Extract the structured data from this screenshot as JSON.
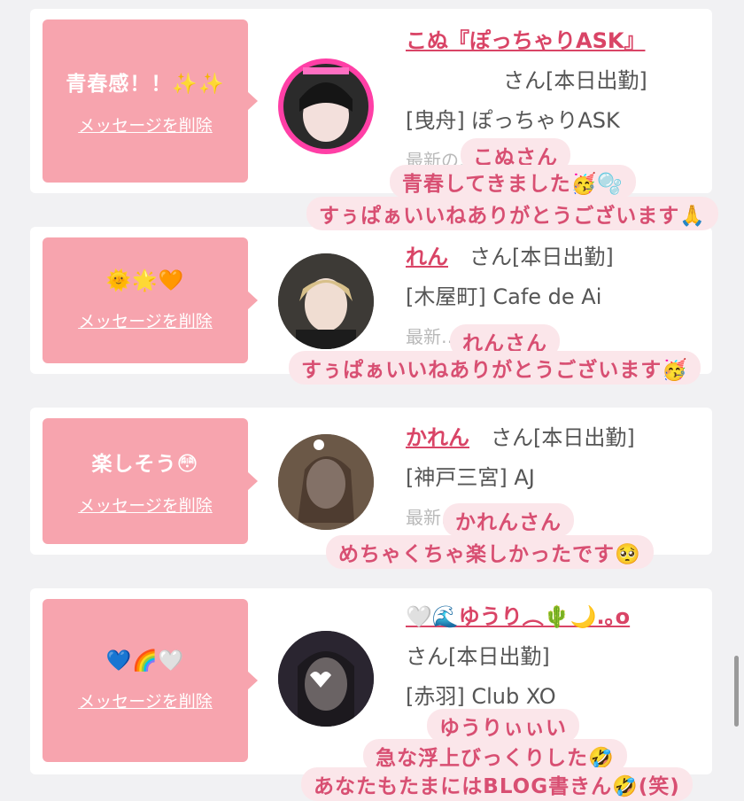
{
  "cards": [
    {
      "message": "青春感！！✨✨",
      "delete_label": "メッセージを削除",
      "name": "こぬ『ぽっちゃりASK』",
      "san": "さん[本日出勤]",
      "shop": "[曳舟] ぽっちゃりASK",
      "faded": "最新の…見る",
      "overlay": [
        "こぬさん",
        "青春してきました🥳🫧",
        "すぅぱぁいいねありがとうございます🙏"
      ]
    },
    {
      "message": "🌞🌟🧡",
      "delete_label": "メッセージを削除",
      "name": "れん",
      "san": "さん[本日出勤]",
      "shop": "[木屋町] Cafe de Ai",
      "faded": "最新…見る",
      "overlay": [
        "れんさん",
        "すぅぱぁいいねありがとうございます🥳"
      ]
    },
    {
      "message": "楽しそう😳",
      "delete_label": "メッセージを削除",
      "name": "かれん",
      "san": "さん[本日出勤]",
      "shop": "[神戸三宮] AJ",
      "faded": "最新…る",
      "overlay": [
        "かれんさん",
        "めちゃくちゃ楽しかったです🥺"
      ]
    },
    {
      "message": "💙🌈🤍",
      "delete_label": "メッセージを削除",
      "name": "🤍🌊ゆうり︵🌵🌙.｡o",
      "san": "さん[本日出勤]",
      "shop": "[赤羽] Club XO",
      "faded": "",
      "overlay": [
        "ゆうりぃぃい",
        "急な浮上びっくりした🤣",
        "あなたもたまにはBLOG書きん🤣(笑)"
      ]
    }
  ]
}
